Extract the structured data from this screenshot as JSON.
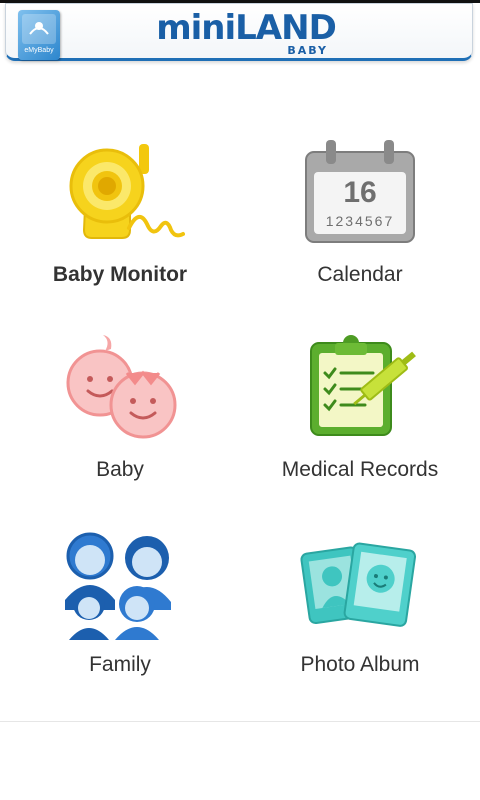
{
  "header": {
    "app_icon_label": "eMyBaby",
    "brand_name": "miniLAND",
    "brand_sub": "BABY"
  },
  "tiles": [
    {
      "id": "baby-monitor",
      "label": "Baby Monitor",
      "icon": "baby-monitor-icon"
    },
    {
      "id": "calendar",
      "label": "Calendar",
      "icon": "calendar-icon",
      "day": "16",
      "week": "1234567"
    },
    {
      "id": "baby",
      "label": "Baby",
      "icon": "babies-icon"
    },
    {
      "id": "medical-records",
      "label": "Medical Records",
      "icon": "medical-clipboard-icon"
    },
    {
      "id": "family",
      "label": "Family",
      "icon": "family-icon"
    },
    {
      "id": "photo-album",
      "label": "Photo Album",
      "icon": "photo-album-icon"
    }
  ],
  "colors": {
    "brand_blue": "#1a5fa6",
    "monitor_yellow": "#f6d31d",
    "calendar_gray": "#8d8d8d",
    "baby_pink": "#f5a3a3",
    "medical_green": "#7bbb2c",
    "family_blue": "#1c5fae",
    "album_teal": "#3fc5c0"
  }
}
